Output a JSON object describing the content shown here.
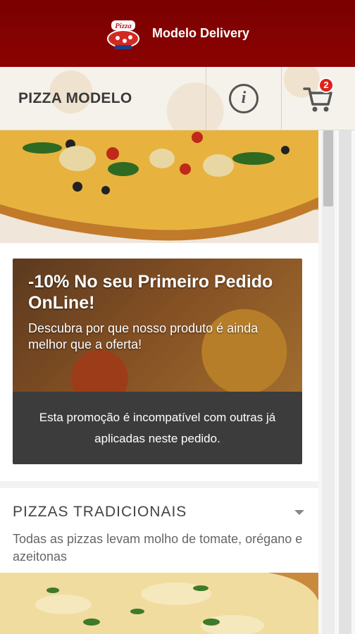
{
  "header": {
    "brand": "Modelo Delivery",
    "logo_text": "Pizza"
  },
  "subheader": {
    "store_name": "PIZZA MODELO",
    "info_icon_glyph": "i",
    "cart_count": "2"
  },
  "promo": {
    "title": "-10% No seu Primeiro Pedido OnLine!",
    "description": "Descubra por que nosso produto é ainda melhor que a oferta!",
    "notice": "Esta promoção é incompatível com outras já aplicadas neste pedido."
  },
  "category": {
    "title": "PIZZAS TRADICIONAIS",
    "description": "Todas as pizzas levam molho de tomate, orégano e azeitonas"
  },
  "colors": {
    "header_bg": "#8c0303",
    "badge": "#e0211c",
    "promo_notice_bg": "#3c3c3c"
  },
  "icons": {
    "info": "info-icon",
    "cart": "cart-icon",
    "chevron": "chevron-down-icon"
  }
}
